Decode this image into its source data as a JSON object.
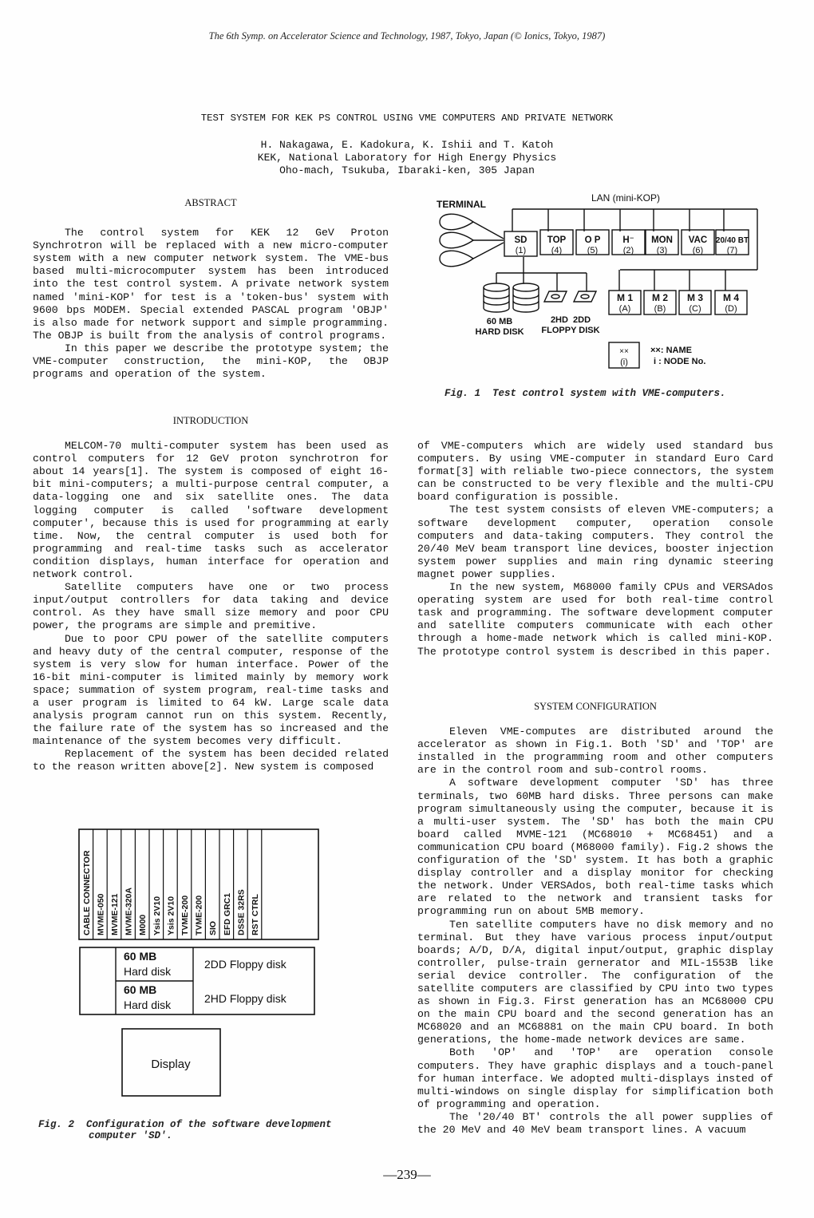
{
  "header": {
    "conference": "The 6th Symp. on Accelerator Science and Technology, 1987, Tokyo, Japan (© Ionics, Tokyo, 1987)"
  },
  "title": "TEST SYSTEM FOR KEK PS CONTROL USING VME COMPUTERS AND PRIVATE NETWORK",
  "authors": {
    "names": "H. Nakagawa, E. Kadokura, K. Ishii and T. Katoh",
    "affiliation": "KEK, National Laboratory for High Energy Physics",
    "address": "Oho-mach, Tsukuba, Ibaraki-ken, 305 Japan"
  },
  "abstract": {
    "heading": "ABSTRACT",
    "paragraphs": [
      "The control system for KEK 12 GeV Proton Synchrotron will be replaced with a new micro-computer system with a new computer network system. The VME-bus based multi-microcomputer system has been introduced into the test control system. A private network system named 'mini-KOP' for test is a 'token-bus' system with 9600 bps MODEM. Special extended PASCAL program 'OBJP' is also made for network support and simple programming. The OBJP is built from the analysis of control programs.",
      "In this paper we describe the prototype system; the VME-computer construction, the mini-KOP, the OBJP programs and operation of the system."
    ]
  },
  "introduction": {
    "heading": "INTRODUCTION",
    "paragraphs": [
      "MELCOM-70 multi-computer system has been used as control computers for 12 GeV proton synchrotron for about 14 years[1]. The system is composed of eight 16-bit mini-computers; a multi-purpose central computer, a data-logging one and six satellite ones. The data logging computer is called 'software development computer', because this is used for programming at early time. Now, the central computer is used both for programming and real-time tasks such as accelerator condition displays, human interface for operation and network control.",
      "Satellite computers have one or two process input/output controllers for data taking and device control. As they have small size memory and poor CPU power, the programs are simple and premitive.",
      "Due to poor CPU power of the satellite computers and heavy duty of the central computer, response of the system is very slow for human interface. Power of the 16-bit mini-computer is limited mainly by memory work space; summation of system program, real-time tasks and a user program is limited to 64 kW. Large scale data analysis program cannot run on this system. Recently, the failure rate of the system has so increased and the maintenance of the system becomes very difficult.",
      "Replacement of the system has been decided related to the reason written above[2]. New system is composed"
    ],
    "continued_paragraphs": [
      "of VME-computers which are widely used standard bus computers. By using VME-computer in standard Euro Card format[3] with reliable two-piece connectors, the system can be constructed to be very flexible and the multi-CPU board configuration is possible.",
      "The test system consists of eleven VME-computers; a software development computer, operation console computers and data-taking computers. They control the 20/40 MeV beam transport line devices, booster injection system power supplies and main ring dynamic steering magnet power supplies.",
      "In the new system, M68000 family CPUs and VERSAdos operating system are used for both real-time control task and programming. The software development computer and satellite computers communicate with each other through a home-made network which is called mini-KOP. The prototype control system is described in this paper."
    ]
  },
  "system_configuration": {
    "heading": "SYSTEM CONFIGURATION",
    "paragraphs": [
      "Eleven VME-computes are distributed around the accelerator as shown in Fig.1. Both 'SD' and 'TOP' are installed in the programming room and other computers are in the control room and sub-control rooms.",
      "A software development computer 'SD' has three terminals, two 60MB hard disks. Three persons can make program simultaneously using the computer, because it is a multi-user system. The 'SD' has both the main CPU board called MVME-121 (MC68010 + MC68451) and a communication CPU board (M68000 family). Fig.2 shows the configuration of the 'SD' system. It has both a graphic display controller and a display monitor for checking the network. Under VERSAdos, both real-time tasks which are related to the network and transient tasks for programming run on about 5MB memory.",
      "Ten satellite computers have no disk memory and no terminal. But they have various process input/output boards; A/D, D/A, digital input/output, graphic display controller, pulse-train gernerator and MIL-1553B like serial device controller. The configuration of the satellite computers are classified by CPU into two types as shown in Fig.3. First generation has an MC68000 CPU on the main CPU board and the second generation has an MC68020 and an MC68881 on the main CPU board. In both generations, the home-made network devices are same.",
      "Both 'OP' and 'TOP' are operation console computers. They have graphic displays and a touch-panel for human interface. We adopted multi-displays insted of multi-windows on single display for simplification both of programming and operation.",
      "The '20/40 BT' controls the all power supplies of the 20 MeV and 40 MeV beam transport lines. A vacuum"
    ]
  },
  "figure1": {
    "terminal_label": "TERMINAL",
    "lan_label": "LAN (mini-KOP)",
    "top_nodes": [
      {
        "name": "SD",
        "node": "(1)"
      },
      {
        "name": "TOP",
        "node": "(4)"
      },
      {
        "name": "O P",
        "node": "(5)"
      },
      {
        "name": "H⁻",
        "node": "(2)"
      },
      {
        "name": "MON",
        "node": "(3)"
      },
      {
        "name": "VAC",
        "node": "(6)"
      },
      {
        "name": "20/40 BT",
        "node": "(7)"
      }
    ],
    "bottom_nodes": [
      {
        "name": "M 1",
        "node": "(A)"
      },
      {
        "name": "M 2",
        "node": "(B)"
      },
      {
        "name": "M 3",
        "node": "(C)"
      },
      {
        "name": "M 4",
        "node": "(D)"
      }
    ],
    "hard_disk_label_1": "60 MB",
    "hard_disk_label_2": "HARD DISK",
    "floppy_label_1": "2HD  2DD",
    "floppy_label_2": "FLOPPY DISK",
    "legend_box_name": "××",
    "legend_box_node": "(i)",
    "legend_name_text": "××: NAME",
    "legend_node_text": "i : NODE No.",
    "caption": "Fig. 1  Test control system with VME-computers."
  },
  "figure2": {
    "slots": [
      "CABLE CONNECTOR",
      "MVME-050",
      "MVME-121",
      "MVME-320A",
      "M000",
      "Ysis 2V10",
      "Ysis 2V10",
      "TVME-200",
      "TVME-200",
      "SIO",
      "EFD GRC1",
      "DSSE 32RS",
      "RST CTRL"
    ],
    "hard_disk_1": [
      "60 MB",
      "Hard disk"
    ],
    "hard_disk_2": [
      "60 MB",
      "Hard disk"
    ],
    "floppy_1": "2DD Floppy disk",
    "floppy_2": "2HD Floppy disk",
    "display": "Display",
    "caption_line1": "Fig. 2  Configuration of the software development",
    "caption_line2": "computer 'SD'."
  },
  "page_number": "—239—"
}
